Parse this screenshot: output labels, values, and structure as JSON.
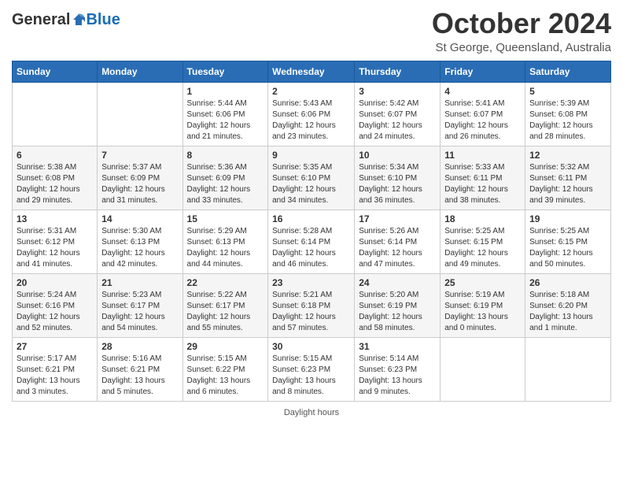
{
  "header": {
    "logo_general": "General",
    "logo_blue": "Blue",
    "month_title": "October 2024",
    "location": "St George, Queensland, Australia"
  },
  "days_of_week": [
    "Sunday",
    "Monday",
    "Tuesday",
    "Wednesday",
    "Thursday",
    "Friday",
    "Saturday"
  ],
  "weeks": [
    [
      {
        "day": "",
        "info": ""
      },
      {
        "day": "",
        "info": ""
      },
      {
        "day": "1",
        "info": "Sunrise: 5:44 AM\nSunset: 6:06 PM\nDaylight: 12 hours and 21 minutes."
      },
      {
        "day": "2",
        "info": "Sunrise: 5:43 AM\nSunset: 6:06 PM\nDaylight: 12 hours and 23 minutes."
      },
      {
        "day": "3",
        "info": "Sunrise: 5:42 AM\nSunset: 6:07 PM\nDaylight: 12 hours and 24 minutes."
      },
      {
        "day": "4",
        "info": "Sunrise: 5:41 AM\nSunset: 6:07 PM\nDaylight: 12 hours and 26 minutes."
      },
      {
        "day": "5",
        "info": "Sunrise: 5:39 AM\nSunset: 6:08 PM\nDaylight: 12 hours and 28 minutes."
      }
    ],
    [
      {
        "day": "6",
        "info": "Sunrise: 5:38 AM\nSunset: 6:08 PM\nDaylight: 12 hours and 29 minutes."
      },
      {
        "day": "7",
        "info": "Sunrise: 5:37 AM\nSunset: 6:09 PM\nDaylight: 12 hours and 31 minutes."
      },
      {
        "day": "8",
        "info": "Sunrise: 5:36 AM\nSunset: 6:09 PM\nDaylight: 12 hours and 33 minutes."
      },
      {
        "day": "9",
        "info": "Sunrise: 5:35 AM\nSunset: 6:10 PM\nDaylight: 12 hours and 34 minutes."
      },
      {
        "day": "10",
        "info": "Sunrise: 5:34 AM\nSunset: 6:10 PM\nDaylight: 12 hours and 36 minutes."
      },
      {
        "day": "11",
        "info": "Sunrise: 5:33 AM\nSunset: 6:11 PM\nDaylight: 12 hours and 38 minutes."
      },
      {
        "day": "12",
        "info": "Sunrise: 5:32 AM\nSunset: 6:11 PM\nDaylight: 12 hours and 39 minutes."
      }
    ],
    [
      {
        "day": "13",
        "info": "Sunrise: 5:31 AM\nSunset: 6:12 PM\nDaylight: 12 hours and 41 minutes."
      },
      {
        "day": "14",
        "info": "Sunrise: 5:30 AM\nSunset: 6:13 PM\nDaylight: 12 hours and 42 minutes."
      },
      {
        "day": "15",
        "info": "Sunrise: 5:29 AM\nSunset: 6:13 PM\nDaylight: 12 hours and 44 minutes."
      },
      {
        "day": "16",
        "info": "Sunrise: 5:28 AM\nSunset: 6:14 PM\nDaylight: 12 hours and 46 minutes."
      },
      {
        "day": "17",
        "info": "Sunrise: 5:26 AM\nSunset: 6:14 PM\nDaylight: 12 hours and 47 minutes."
      },
      {
        "day": "18",
        "info": "Sunrise: 5:25 AM\nSunset: 6:15 PM\nDaylight: 12 hours and 49 minutes."
      },
      {
        "day": "19",
        "info": "Sunrise: 5:25 AM\nSunset: 6:15 PM\nDaylight: 12 hours and 50 minutes."
      }
    ],
    [
      {
        "day": "20",
        "info": "Sunrise: 5:24 AM\nSunset: 6:16 PM\nDaylight: 12 hours and 52 minutes."
      },
      {
        "day": "21",
        "info": "Sunrise: 5:23 AM\nSunset: 6:17 PM\nDaylight: 12 hours and 54 minutes."
      },
      {
        "day": "22",
        "info": "Sunrise: 5:22 AM\nSunset: 6:17 PM\nDaylight: 12 hours and 55 minutes."
      },
      {
        "day": "23",
        "info": "Sunrise: 5:21 AM\nSunset: 6:18 PM\nDaylight: 12 hours and 57 minutes."
      },
      {
        "day": "24",
        "info": "Sunrise: 5:20 AM\nSunset: 6:19 PM\nDaylight: 12 hours and 58 minutes."
      },
      {
        "day": "25",
        "info": "Sunrise: 5:19 AM\nSunset: 6:19 PM\nDaylight: 13 hours and 0 minutes."
      },
      {
        "day": "26",
        "info": "Sunrise: 5:18 AM\nSunset: 6:20 PM\nDaylight: 13 hours and 1 minute."
      }
    ],
    [
      {
        "day": "27",
        "info": "Sunrise: 5:17 AM\nSunset: 6:21 PM\nDaylight: 13 hours and 3 minutes."
      },
      {
        "day": "28",
        "info": "Sunrise: 5:16 AM\nSunset: 6:21 PM\nDaylight: 13 hours and 5 minutes."
      },
      {
        "day": "29",
        "info": "Sunrise: 5:15 AM\nSunset: 6:22 PM\nDaylight: 13 hours and 6 minutes."
      },
      {
        "day": "30",
        "info": "Sunrise: 5:15 AM\nSunset: 6:23 PM\nDaylight: 13 hours and 8 minutes."
      },
      {
        "day": "31",
        "info": "Sunrise: 5:14 AM\nSunset: 6:23 PM\nDaylight: 13 hours and 9 minutes."
      },
      {
        "day": "",
        "info": ""
      },
      {
        "day": "",
        "info": ""
      }
    ]
  ],
  "footer": "Daylight hours"
}
